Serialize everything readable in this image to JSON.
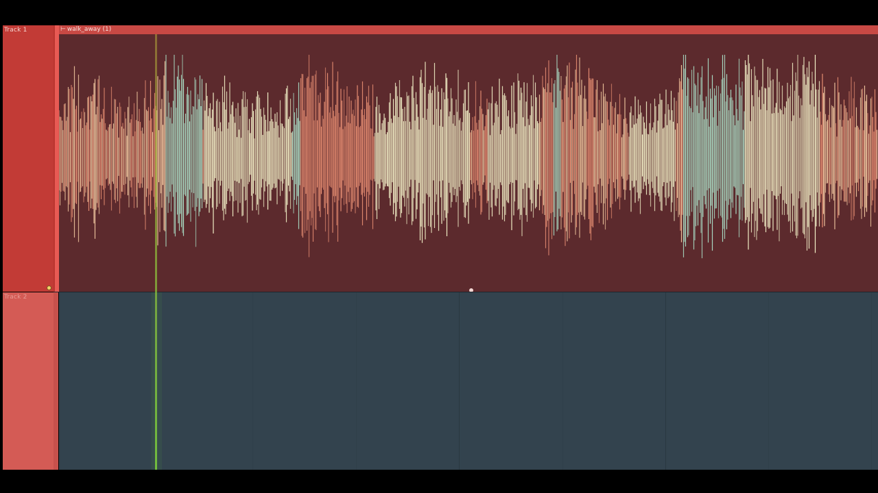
{
  "tracks": [
    {
      "name": "Track 1"
    },
    {
      "name": "Track 2"
    }
  ],
  "clip": {
    "title": "walk_away (1)",
    "arrow_icon": "⊢"
  },
  "colors": {
    "track1_header": "#c23b36",
    "track2_header": "#d45b55",
    "clip_body": "#5c2a2d",
    "clip_title_bar": "#c84944",
    "lane2_background": "#33434e",
    "playhead": "#7ecf3c",
    "wave_peach": "#f2c8a0",
    "wave_cream": "#f3f1c8",
    "wave_teal": "#a9dcc4",
    "wave_salmon": "#e68d72"
  }
}
